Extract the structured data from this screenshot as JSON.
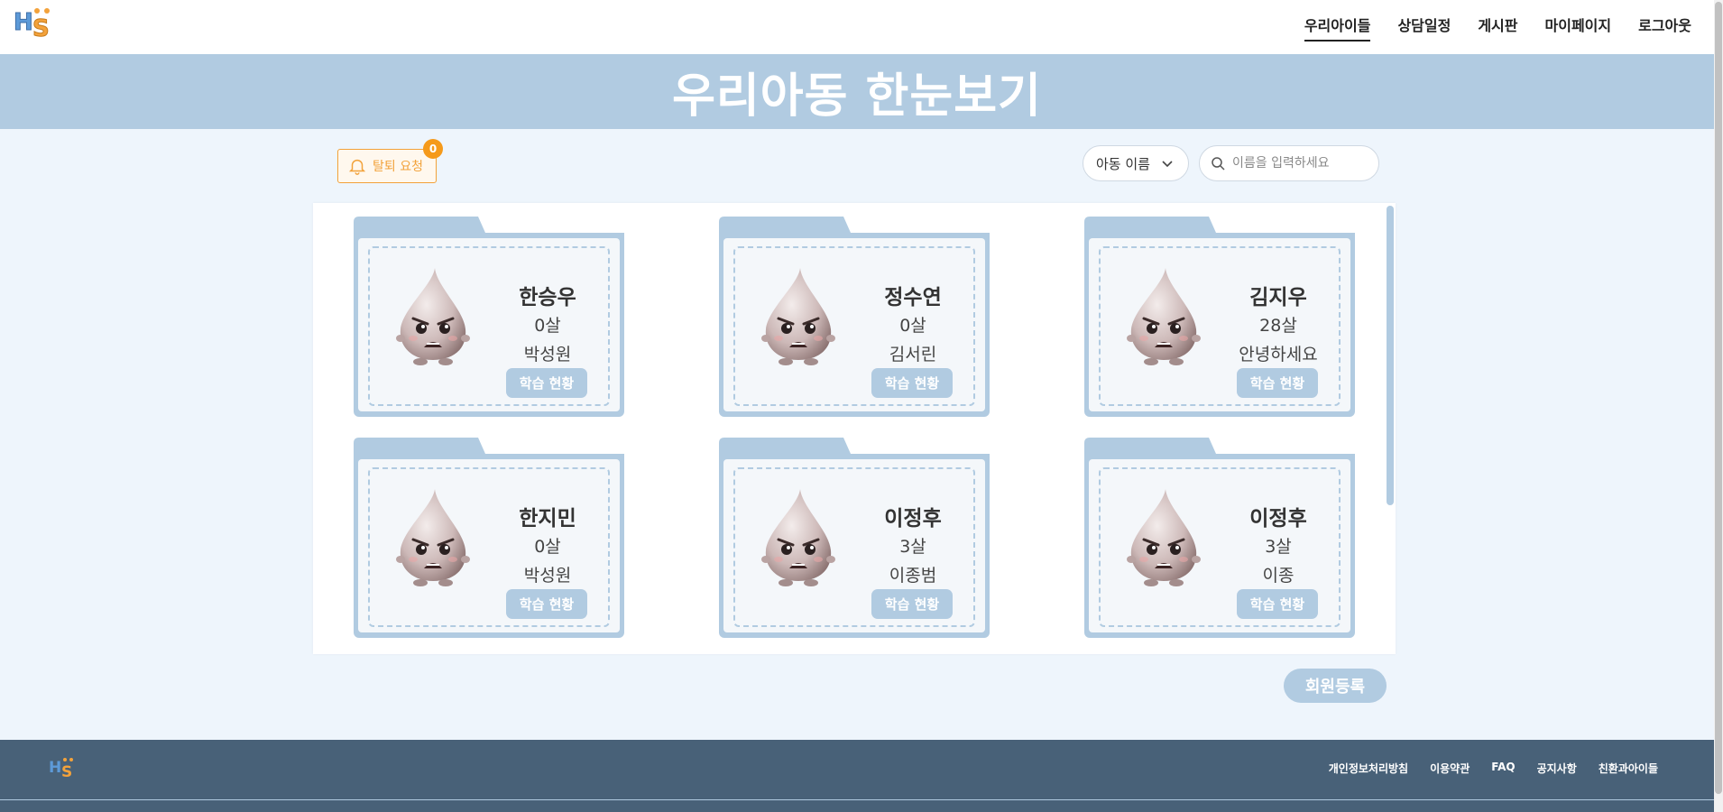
{
  "header": {
    "logo_text": "HS",
    "nav": [
      {
        "label": "우리아이들",
        "active": true
      },
      {
        "label": "상담일정",
        "active": false
      },
      {
        "label": "게시판",
        "active": false
      },
      {
        "label": "마이페이지",
        "active": false
      },
      {
        "label": "로그아웃",
        "active": false
      }
    ]
  },
  "banner": {
    "title": "우리아동 한눈보기"
  },
  "toolbar": {
    "withdraw_label": "탈퇴 요청",
    "withdraw_count": "0",
    "filter_selected": "아동 이름",
    "search_placeholder": "이름을 입력하세요"
  },
  "children": [
    {
      "name": "한승우",
      "age": "0살",
      "parent": "박성원",
      "button": "학습 현황"
    },
    {
      "name": "정수연",
      "age": "0살",
      "parent": "김서린",
      "button": "학습 현황"
    },
    {
      "name": "김지우",
      "age": "28살",
      "parent": "안녕하세요",
      "button": "학습 현황"
    },
    {
      "name": "한지민",
      "age": "0살",
      "parent": "박성원",
      "button": "학습 현황"
    },
    {
      "name": "이정후",
      "age": "3살",
      "parent": "이종범",
      "button": "학습 현황"
    },
    {
      "name": "이정후",
      "age": "3살",
      "parent": "이종",
      "button": "학습 현황"
    }
  ],
  "register_label": "회원등록",
  "footer": {
    "links": [
      "개인정보처리방침",
      "이용약관",
      "FAQ",
      "공지사항",
      "친환과아이들"
    ]
  },
  "colors": {
    "accent": "#b1cbe1",
    "footer_bg": "#486178",
    "warning": "#f2a23a"
  }
}
